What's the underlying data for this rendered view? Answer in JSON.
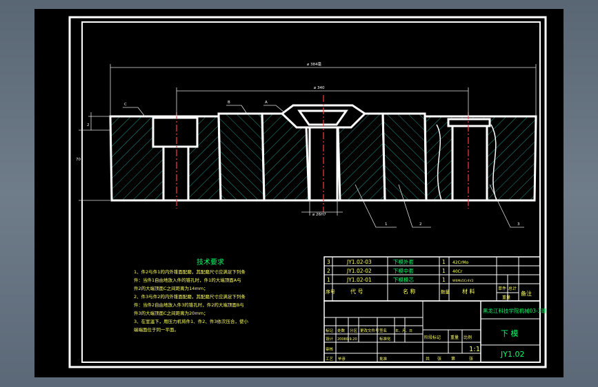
{
  "dimensions": {
    "total_width": "⌀ 384毫",
    "inner_width": "⌀ 340",
    "bore": "⌀ 26H7",
    "height": "70",
    "top_offset": "2"
  },
  "callouts": {
    "c": "C",
    "b": "B",
    "a": "A",
    "p1": "1",
    "p2": "2",
    "p3": "3"
  },
  "tech": {
    "title": "技术要求",
    "lines": [
      "1、件2与件1的内外锥面配磨，其配磨尺寸应满足下列条",
      "   件：当件1自由地放入件的锥孔时，件1的大端顶面A与",
      "   件2的大端顶面C之间距离为14mm；",
      "2、件3与件2的内外锥面配磨，其配磨尺寸应满足下列条",
      "   件：当件2自由地放入件3的锥孔时，件2的大端顶面B与",
      "   件3的大端顶面C之间距离为20mm；",
      "3、在室温下，用压力机将件1、件2、件3依次压合，使小",
      "   端端面位于同一平面。"
    ]
  },
  "bom": {
    "rows": [
      {
        "no": "3",
        "code": "JY1.02-03",
        "name": "下模外套",
        "qty": "1",
        "mat": "42CrMo"
      },
      {
        "no": "2",
        "code": "JY1.02-02",
        "name": "下模中套",
        "qty": "1",
        "mat": "40Cr"
      },
      {
        "no": "1",
        "code": "JY1.02-01",
        "name": "下模模芯",
        "qty": "1",
        "mat": "W6Mo5Cr4V2"
      }
    ],
    "header": {
      "no": "序号",
      "code": "代  号",
      "name": "名  称",
      "qty": "数量",
      "mat": "材  料",
      "unit": "单件",
      "total": "总计",
      "note": "备注",
      "weight": "重量"
    }
  },
  "titleblock": {
    "school": "黑龙江科技学院机械03-3班",
    "name": "下   模",
    "drawing_no": "JY1.02",
    "scale": "1:1",
    "f_stage": "阶段标记",
    "f_weight": "重量",
    "f_scale": "比例",
    "f_sheet_total": "共",
    "f_sheet": "张",
    "f_sheet_no": "第",
    "r_mark": "标记",
    "r_count": "处数",
    "r_zone": "分区",
    "r_change": "更改文件号",
    "r_sign": "签名",
    "r_date": "年、月、日",
    "r_design": "设计",
    "r_std": "标准化",
    "r_check": "审核",
    "r_craft": "工艺",
    "r_approve": "批准",
    "r_name": "毕彦",
    "r_date_val": "20080.9.20"
  }
}
